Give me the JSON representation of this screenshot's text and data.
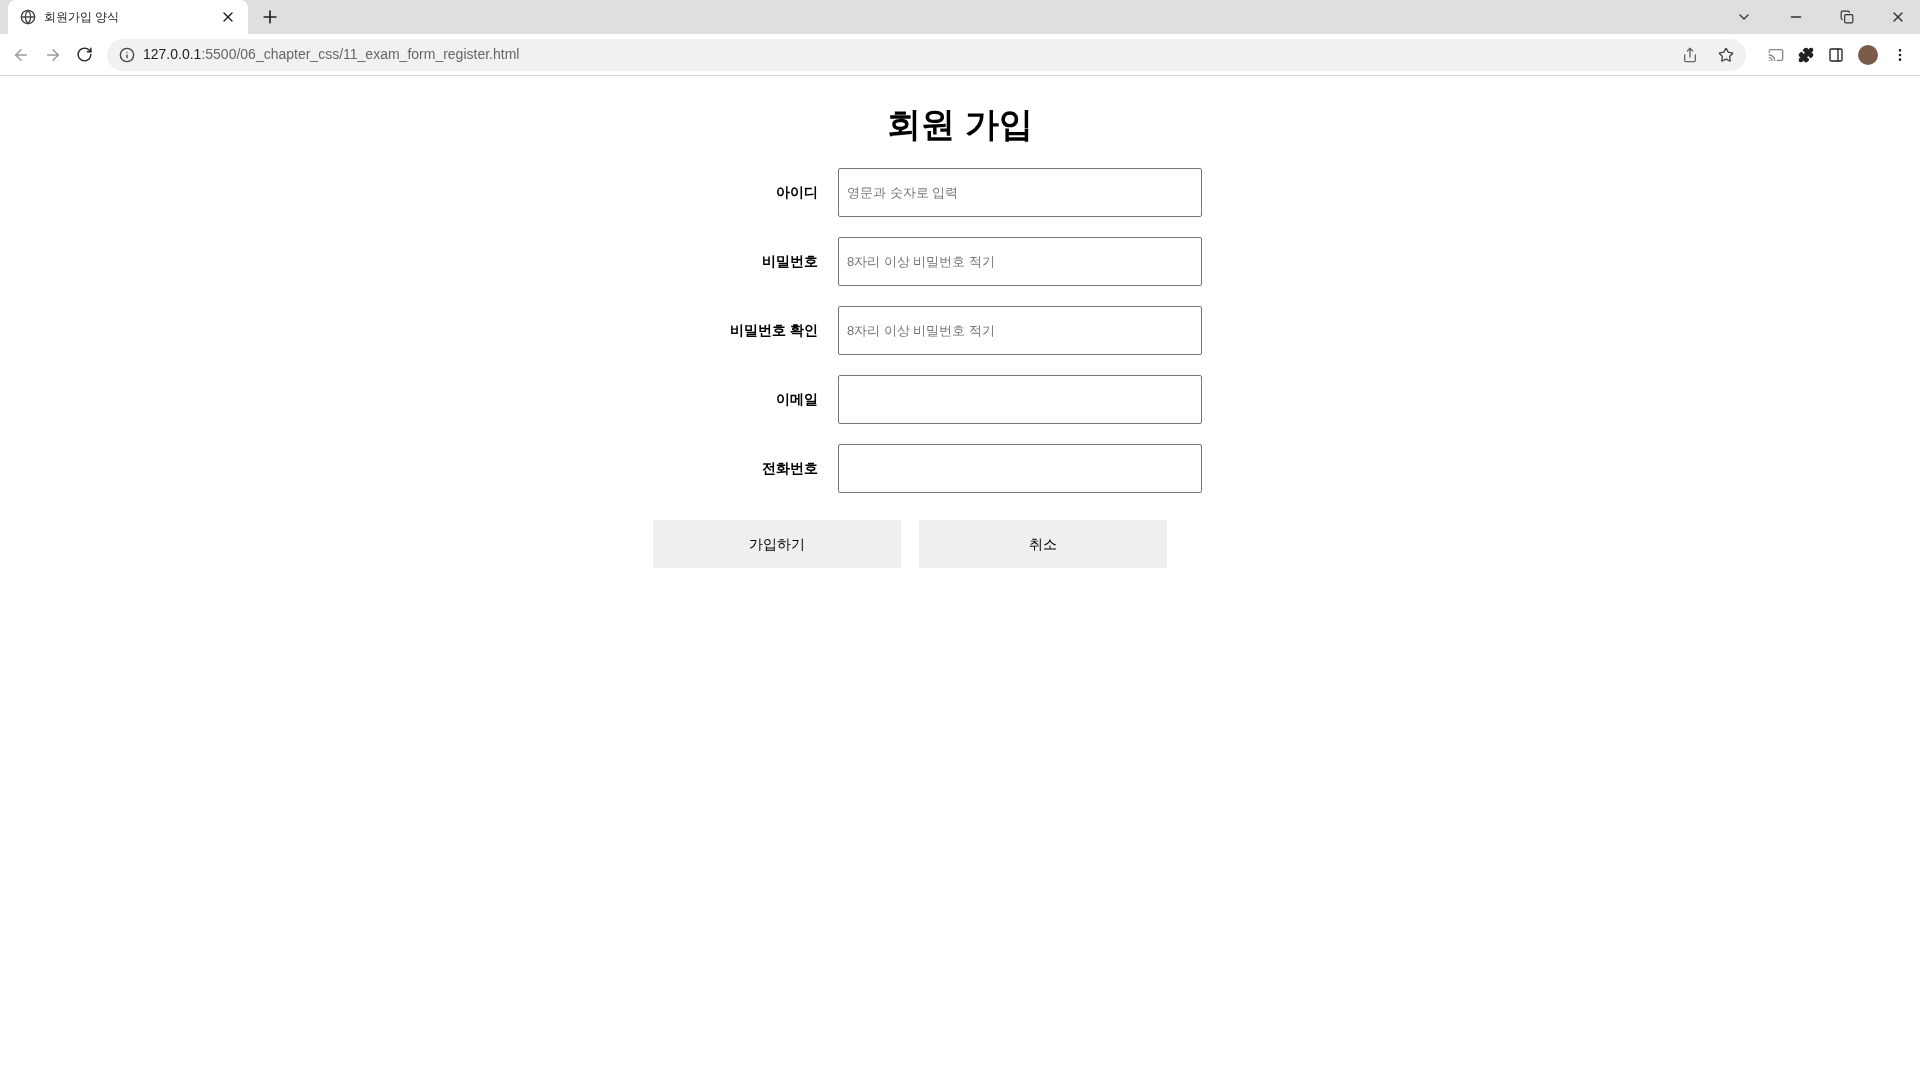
{
  "browser": {
    "tabs": [
      {
        "title": "회원가입 양식",
        "selected": true
      }
    ],
    "address": {
      "host": "127.0.0.1",
      "path": ":5500/06_chapter_css/11_exam_form_register.html"
    }
  },
  "page": {
    "title": "회원 가입",
    "fields": [
      {
        "label": "아이디",
        "placeholder": "영문과 숫자로 입력"
      },
      {
        "label": "비밀번호",
        "placeholder": "8자리 이상 비밀번호 적기"
      },
      {
        "label": "비밀번호 확인",
        "placeholder": "8자리 이상 비밀번호 적기"
      },
      {
        "label": "이메일"
      },
      {
        "label": "전화번호"
      }
    ],
    "buttons": [
      "가입하기",
      "취소"
    ]
  }
}
